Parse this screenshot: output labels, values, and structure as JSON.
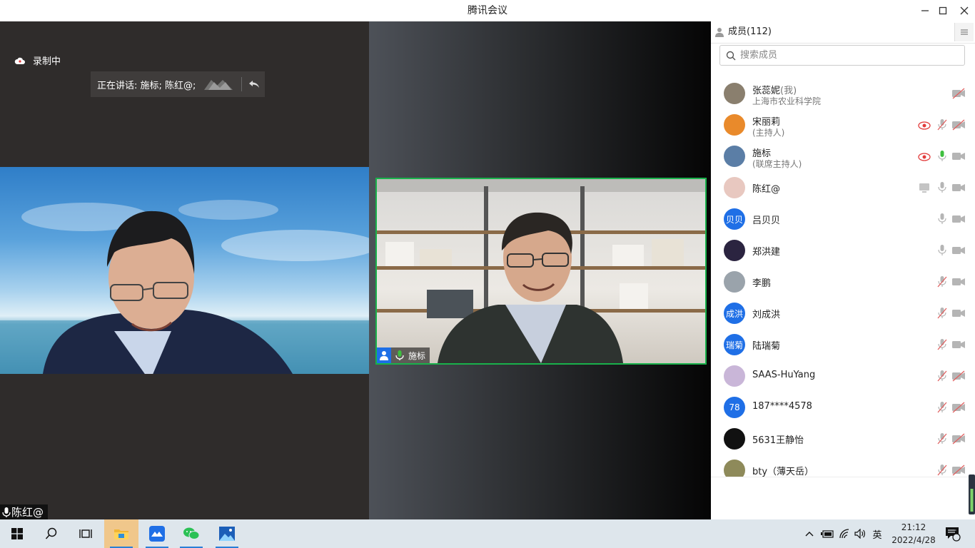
{
  "app": {
    "title": "腾讯会议"
  },
  "recording": {
    "label": "录制中"
  },
  "speaking": {
    "label": "正在讲话: 施标; 陈红@;"
  },
  "videos": [
    {
      "name": "陈红@"
    },
    {
      "name": "施标"
    }
  ],
  "panel": {
    "title": "成员(112)",
    "search_placeholder": "搜索成员",
    "members": [
      {
        "name": "张蕊妮",
        "tag": "(我)",
        "sub": "上海市农业科学院",
        "avatar_text": "",
        "avatar_color": "#8a7f6e",
        "mic": "none",
        "cam": "off",
        "extra": ""
      },
      {
        "name": "宋丽莉",
        "tag": "",
        "sub": "(主持人)",
        "avatar_text": "",
        "avatar_color": "#e98a2b",
        "mic": "off",
        "cam": "off",
        "extra": "recording"
      },
      {
        "name": "施标",
        "tag": "",
        "sub": "(联席主持人)",
        "avatar_text": "",
        "avatar_color": "#5b7ea6",
        "mic": "active",
        "cam": "on",
        "extra": "recording"
      },
      {
        "name": "陈红@",
        "tag": "",
        "sub": "",
        "avatar_text": "",
        "avatar_color": "#e8c8c0",
        "mic": "on",
        "cam": "on",
        "extra": "screen"
      },
      {
        "name": "吕贝贝",
        "tag": "",
        "sub": "",
        "avatar_text": "贝贝",
        "avatar_color": "#1f6fe6",
        "mic": "on",
        "cam": "on",
        "extra": ""
      },
      {
        "name": "郑洪建",
        "tag": "",
        "sub": "",
        "avatar_text": "",
        "avatar_color": "#2b2440",
        "mic": "on",
        "cam": "on",
        "extra": ""
      },
      {
        "name": "李鹏",
        "tag": "",
        "sub": "",
        "avatar_text": "",
        "avatar_color": "#9aa3ab",
        "mic": "off",
        "cam": "on",
        "extra": ""
      },
      {
        "name": "刘成洪",
        "tag": "",
        "sub": "",
        "avatar_text": "成洪",
        "avatar_color": "#1f6fe6",
        "mic": "off",
        "cam": "on",
        "extra": ""
      },
      {
        "name": "陆瑞菊",
        "tag": "",
        "sub": "",
        "avatar_text": "瑞菊",
        "avatar_color": "#1f6fe6",
        "mic": "off",
        "cam": "on",
        "extra": ""
      },
      {
        "name": " SAAS-HuYang",
        "tag": "",
        "sub": "",
        "avatar_text": "",
        "avatar_color": "#c9b6d8",
        "mic": "off",
        "cam": "off",
        "extra": ""
      },
      {
        "name": "187****4578",
        "tag": "",
        "sub": "",
        "avatar_text": "78",
        "avatar_color": "#1f6fe6",
        "mic": "off",
        "cam": "off",
        "extra": ""
      },
      {
        "name": "5631王静怡",
        "tag": "",
        "sub": "",
        "avatar_text": "",
        "avatar_color": "#111111",
        "mic": "off",
        "cam": "off",
        "extra": ""
      },
      {
        "name": "bty（薄天岳）",
        "tag": "",
        "sub": "",
        "avatar_text": "",
        "avatar_color": "#8e8a5a",
        "mic": "off",
        "cam": "off",
        "extra": ""
      }
    ]
  },
  "taskbar": {
    "apps": [
      "start-icon",
      "search-icon",
      "task-view-icon",
      "file-explorer-icon",
      "tencent-meeting-icon",
      "wechat-icon",
      "photos-icon"
    ],
    "ime": "英",
    "time": "21:12",
    "date": "2022/4/28",
    "notifications": "1"
  },
  "colors": {
    "speaker_border": "#19b14b",
    "accent": "#1f6fe6",
    "recording_red": "#e23b3b",
    "mic_green": "#3fbf3f"
  }
}
